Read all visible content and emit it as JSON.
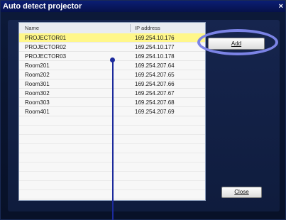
{
  "window": {
    "title": "Auto detect projector",
    "close_glyph": "×"
  },
  "table": {
    "columns": [
      "Name",
      "IP address"
    ],
    "rows": [
      {
        "name": "PROJECTOR01",
        "ip": "169.254.10.176",
        "selected": true
      },
      {
        "name": "PROJECTOR02",
        "ip": "169.254.10.177"
      },
      {
        "name": "PROJECTOR03",
        "ip": "169.254.10.178"
      },
      {
        "name": "Room201",
        "ip": "169.254.207.64"
      },
      {
        "name": "Room202",
        "ip": "169.254.207.65"
      },
      {
        "name": "Room301",
        "ip": "169.254.207.66"
      },
      {
        "name": "Room302",
        "ip": "169.254.207.67"
      },
      {
        "name": "Room303",
        "ip": "169.254.207.68"
      },
      {
        "name": "Room401",
        "ip": "169.254.207.69"
      }
    ]
  },
  "buttons": {
    "add": "Add",
    "close": "Close"
  },
  "colors": {
    "selected_row": "#fff78a",
    "highlight_oval": "#7b83e6",
    "callout": "#1c2a9c"
  }
}
